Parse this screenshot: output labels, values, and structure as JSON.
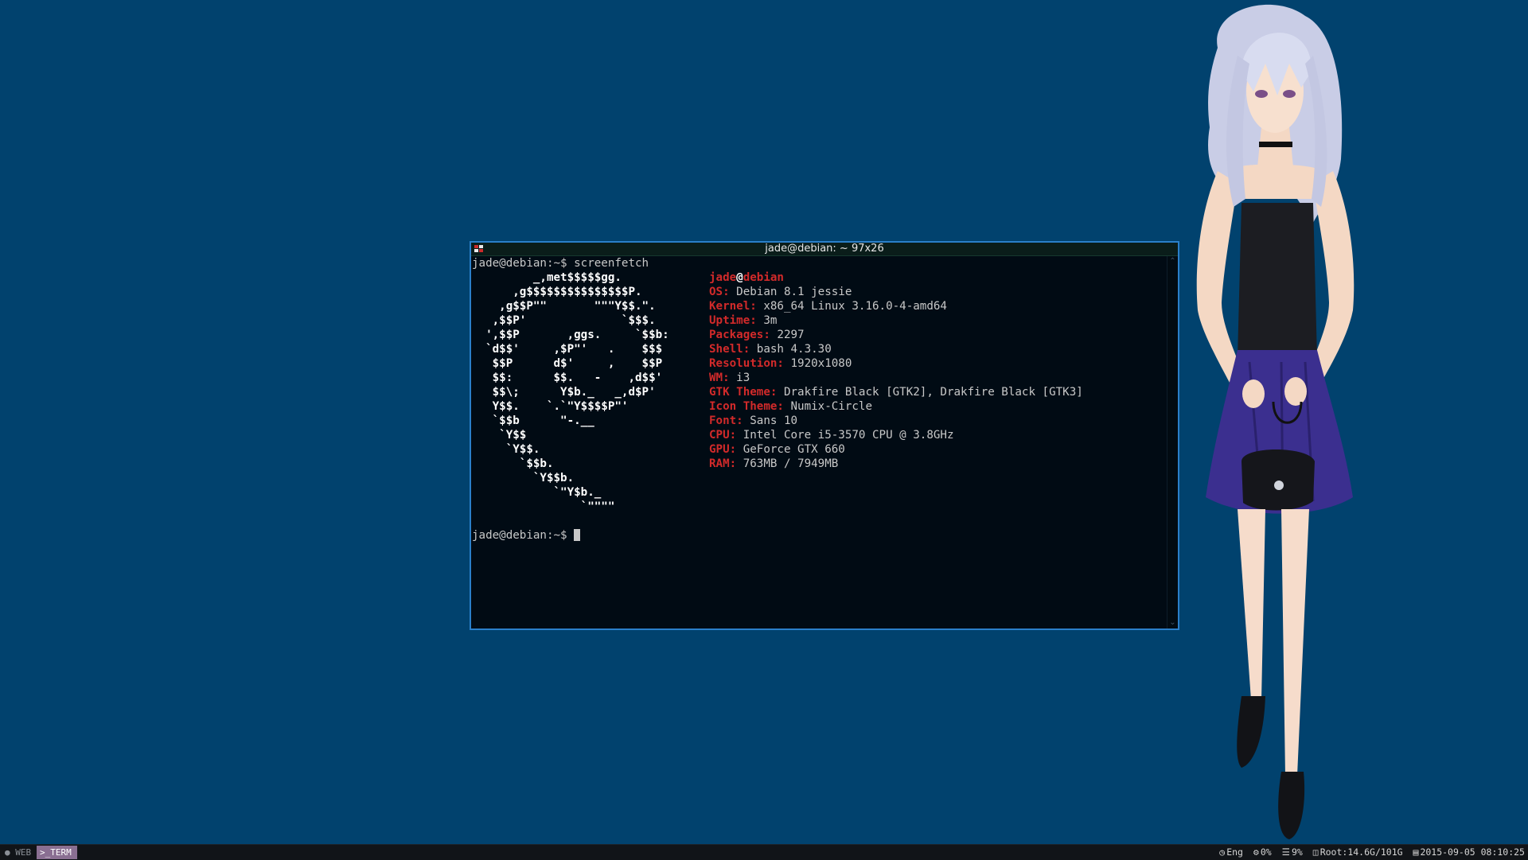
{
  "terminal": {
    "title": "jade@debian: ~ 97x26",
    "command_prompt": "jade@debian:~$ ",
    "command": "screenfetch",
    "final_prompt": "jade@debian:~$ "
  },
  "screenfetch": {
    "user": "jade",
    "at": "@",
    "host": "debian",
    "logo_lines": [
      "         _,met$$$$$gg.",
      "      ,g$$$$$$$$$$$$$$$P.",
      "    ,g$$P\"\"       \"\"\"Y$$.\".",
      "   ,$$P'              `$$$.",
      "  ',$$P       ,ggs.     `$$b:",
      "  `d$$'     ,$P\"'   .    $$$",
      "   $$P      d$'     ,    $$P",
      "   $$:      $$.   -    ,d$$'",
      "   $$\\;      Y$b._   _,d$P'",
      "   Y$$.    `.`\"Y$$$$P\"'",
      "   `$$b      \"-.__",
      "    `Y$$",
      "     `Y$$.",
      "       `$$b.",
      "         `Y$$b.",
      "            `\"Y$b._",
      "                `\"\"\"\""
    ],
    "info": [
      {
        "label": "OS:",
        "value": "Debian 8.1 jessie"
      },
      {
        "label": "Kernel:",
        "value": "x86_64 Linux 3.16.0-4-amd64"
      },
      {
        "label": "Uptime:",
        "value": "3m"
      },
      {
        "label": "Packages:",
        "value": "2297"
      },
      {
        "label": "Shell:",
        "value": "bash 4.3.30"
      },
      {
        "label": "Resolution:",
        "value": "1920x1080"
      },
      {
        "label": "WM:",
        "value": "i3"
      },
      {
        "label": "GTK Theme:",
        "value": "Drakfire Black [GTK2], Drakfire Black [GTK3]"
      },
      {
        "label": "Icon Theme:",
        "value": "Numix-Circle"
      },
      {
        "label": "Font:",
        "value": "Sans 10"
      },
      {
        "label": "CPU:",
        "value": "Intel Core i5-3570 CPU @ 3.8GHz"
      },
      {
        "label": "GPU:",
        "value": "GeForce GTX 660"
      },
      {
        "label": "RAM:",
        "value": "763MB / 7949MB"
      }
    ]
  },
  "bar": {
    "workspaces": [
      {
        "icon": "globe-icon",
        "label": "WEB",
        "active": false
      },
      {
        "icon": "terminal-icon",
        "label": ">_TERM",
        "active": true
      }
    ],
    "status": {
      "language": "Eng",
      "cpu": "0%",
      "memory": "9%",
      "disk": "Root:14.6G/101G",
      "datetime": "2015-09-05 08:10:25"
    }
  },
  "colors": {
    "desktop_bg": "#01426e",
    "terminal_bg": "#010b14",
    "terminal_border": "#2a7fc9",
    "accent_red": "#d22a2a",
    "active_workspace": "#8a6f92"
  }
}
